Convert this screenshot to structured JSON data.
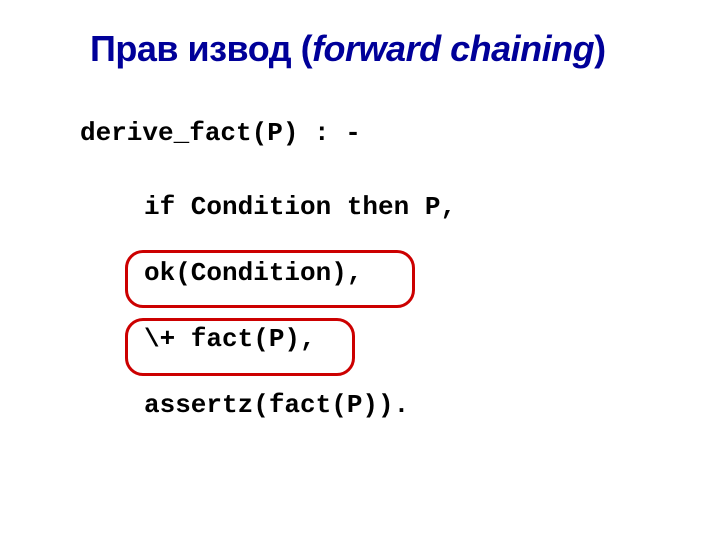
{
  "title": {
    "plain_prefix": "Прав извод (",
    "italic_part": "forward chaining",
    "plain_suffix": ")"
  },
  "code": {
    "line1": "derive_fact(P) : -",
    "line2": "if Condition then P,",
    "line3": "ok(Condition),",
    "line4": "\\+ fact(P),",
    "line5": "assertz(fact(P))."
  }
}
